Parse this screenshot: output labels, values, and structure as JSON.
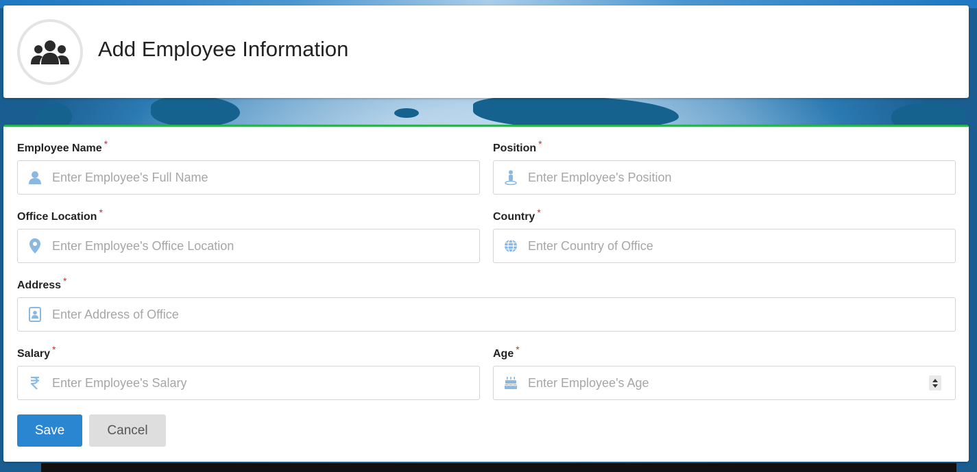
{
  "header": {
    "title": "Add Employee Information",
    "icon": "users-icon"
  },
  "form": {
    "fields": {
      "employee_name": {
        "label": "Employee Name",
        "required": "*",
        "placeholder": "Enter Employee's Full Name",
        "value": "",
        "icon": "user-icon"
      },
      "position": {
        "label": "Position",
        "required": "*",
        "placeholder": "Enter Employee's Position",
        "value": "",
        "icon": "person-pin-icon"
      },
      "office_location": {
        "label": "Office Location",
        "required": "*",
        "placeholder": "Enter Employee's Office Location",
        "value": "",
        "icon": "map-marker-icon"
      },
      "country": {
        "label": "Country",
        "required": "*",
        "placeholder": "Enter Country of Office",
        "value": "",
        "icon": "globe-icon"
      },
      "address": {
        "label": "Address",
        "required": "*",
        "placeholder": "Enter Address of Office",
        "value": "",
        "icon": "address-book-icon"
      },
      "salary": {
        "label": "Salary",
        "required": "*",
        "placeholder": "Enter Employee's Salary",
        "value": "",
        "icon": "rupee-icon"
      },
      "age": {
        "label": "Age",
        "required": "*",
        "placeholder": "Enter Employee's Age",
        "value": "",
        "icon": "birthday-cake-icon"
      }
    },
    "buttons": {
      "save": "Save",
      "cancel": "Cancel"
    }
  },
  "colors": {
    "accent_blue": "#2a86d1",
    "icon_blue": "#8ab8e0",
    "required_red": "#d9262b",
    "top_border_green": "#2eb14f"
  }
}
